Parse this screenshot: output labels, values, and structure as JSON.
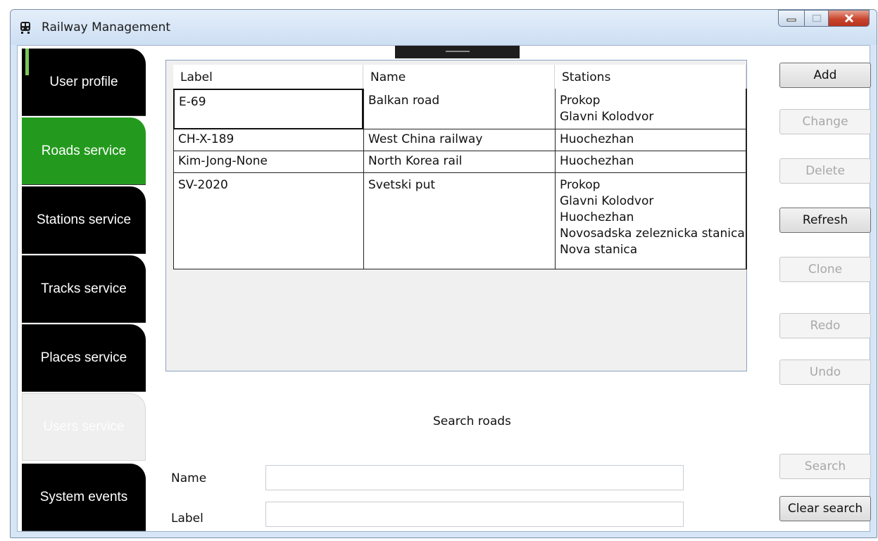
{
  "window": {
    "title": "Railway Management"
  },
  "sidebar": {
    "tabs": [
      {
        "label": "User profile",
        "state": "normal"
      },
      {
        "label": "Roads service",
        "state": "active"
      },
      {
        "label": "Stations service",
        "state": "normal"
      },
      {
        "label": "Tracks service",
        "state": "normal"
      },
      {
        "label": "Places service",
        "state": "normal"
      },
      {
        "label": "Users service",
        "state": "disabled"
      },
      {
        "label": "System events",
        "state": "normal"
      }
    ]
  },
  "table": {
    "columns": [
      "Label",
      "Name",
      "Stations"
    ],
    "rows": [
      {
        "label": "E-69",
        "name": "Balkan road",
        "stations": [
          "Prokop",
          "Glavni Kolodvor"
        ]
      },
      {
        "label": "CH-X-189",
        "name": "West China railway",
        "stations": [
          "Huochezhan"
        ]
      },
      {
        "label": "Kim-Jong-None",
        "name": "North Korea rail",
        "stations": [
          "Huochezhan"
        ]
      },
      {
        "label": "SV-2020",
        "name": "Svetski put",
        "stations": [
          "Prokop",
          "Glavni Kolodvor",
          "Huochezhan",
          "Novosadska zeleznicka stanica",
          "Nova stanica"
        ]
      }
    ]
  },
  "actions": {
    "add": "Add",
    "change": "Change",
    "delete": "Delete",
    "refresh": "Refresh",
    "clone": "Clone",
    "redo": "Redo",
    "undo": "Undo",
    "search": "Search",
    "clear_search": "Clear search"
  },
  "search": {
    "heading": "Search roads",
    "name_label": "Name",
    "name_value": "",
    "label_label": "Label",
    "label_value": ""
  },
  "colors": {
    "active_tab": "#239a1d",
    "tab": "#000000",
    "indicator": "#7ac65a"
  }
}
